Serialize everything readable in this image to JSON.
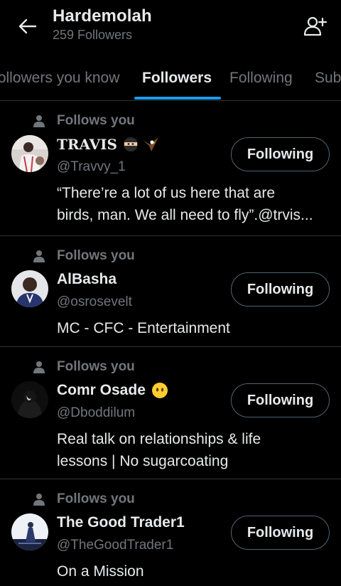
{
  "header": {
    "title": "Hardemolah",
    "subtitle": "259 Followers",
    "back_icon": "arrow-left-icon",
    "add_user_icon": "person-add-icon"
  },
  "tabs": [
    {
      "label": "Followers you know",
      "active": false
    },
    {
      "label": "Followers",
      "active": true
    },
    {
      "label": "Following",
      "active": false
    },
    {
      "label": "Subscriptions",
      "active": false
    }
  ],
  "colors": {
    "background": "#000000",
    "accent": "#1d9bf0",
    "text_primary": "#e7e9ea",
    "text_secondary": "#71767b",
    "divider": "#2f3336"
  },
  "users": [
    {
      "follows_label": "Follows you",
      "name": "TRAVIS",
      "emojis": [
        "ninja-emoji",
        "eagle-emoji"
      ],
      "handle": "@Travvy_1",
      "button": "Following",
      "bio_lines": [
        "“There’re a lot of us here that are",
        "birds, man. We all need to fly”.@trvis..."
      ]
    },
    {
      "follows_label": "Follows you",
      "name": "AlBasha",
      "emojis": [],
      "handle": "@osrosevelt",
      "button": "Following",
      "bio_lines": [
        "MC - CFC - Entertainment"
      ]
    },
    {
      "follows_label": "Follows you",
      "name": "Comr Osade",
      "emojis": [
        "face-without-mouth-emoji"
      ],
      "handle": "@Dboddilum",
      "button": "Following",
      "bio_lines": [
        "Real talk on relationships & life",
        "lessons | No sugarcoating"
      ]
    },
    {
      "follows_label": "Follows you",
      "name": "The Good Trader1",
      "emojis": [],
      "handle": "@TheGoodTrader1",
      "button": "Following",
      "bio_lines": [
        "On a Mission"
      ]
    }
  ]
}
